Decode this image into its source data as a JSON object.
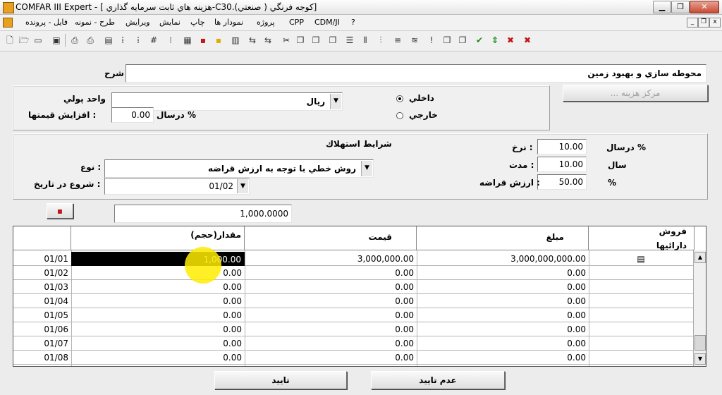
{
  "window": {
    "app_name": "COMFAR III Expert",
    "doc_title": "[ هزينه هاي ثابت سرمايه گذاري-C30.كوجه فرنگي ( صنعتي)]"
  },
  "menu": [
    "فايل - پرونده",
    "طرح - نمونه",
    "ويرايش",
    "نمايش",
    "چاپ",
    "نمودار ها",
    "پروژه",
    "CPP",
    "CDM/JI",
    "?"
  ],
  "form": {
    "description_label": "شرح",
    "description_value": "محوطه سازي و بهبود زمين",
    "currency_label": "واحد پولي",
    "currency_value": "ريال",
    "price_increase_label": ": افزايش قيمتها",
    "price_increase_value": "0.00",
    "percent_per_label": "% درسال",
    "domestic_label": "داخلي",
    "foreign_label": "خارجي",
    "cost_center_button": "... مركز هزينه"
  },
  "depreciation": {
    "title": "شرايط استهلاك",
    "type_label": ": نوع",
    "type_value": "روش خطي با توجه به ارزش قراضه",
    "start_label": ": شروع در تاريخ",
    "start_value": "01/02",
    "rate_label": ": نرخ",
    "rate_value": "10.00",
    "rate_unit": "% درسال",
    "duration_label": ": مدت",
    "duration_value": "10.00",
    "duration_unit": "سال",
    "salvage_label": ": ارزش قراضه",
    "salvage_value": "50.00",
    "salvage_unit": "%"
  },
  "total_value": "1,000.0000",
  "table": {
    "headers": {
      "quantity": "مقدار(حجم)",
      "price": "قيمت",
      "amount": "مبلغ",
      "sale": "فروش",
      "assets": "دارائيها"
    },
    "rows": [
      {
        "period": "01/01",
        "quantity": "1,000.00",
        "price": "3,000,000.00",
        "amount": "3,000,000,000.00"
      },
      {
        "period": "01/02",
        "quantity": "0.00",
        "price": "0.00",
        "amount": "0.00"
      },
      {
        "period": "01/03",
        "quantity": "0.00",
        "price": "0.00",
        "amount": "0.00"
      },
      {
        "period": "01/04",
        "quantity": "0.00",
        "price": "0.00",
        "amount": "0.00"
      },
      {
        "period": "01/05",
        "quantity": "0.00",
        "price": "0.00",
        "amount": "0.00"
      },
      {
        "period": "01/06",
        "quantity": "0.00",
        "price": "0.00",
        "amount": "0.00"
      },
      {
        "period": "01/07",
        "quantity": "0.00",
        "price": "0.00",
        "amount": "0.00"
      },
      {
        "period": "01/08",
        "quantity": "0.00",
        "price": "0.00",
        "amount": "0.00"
      }
    ]
  },
  "buttons": {
    "ok": "تاييد",
    "cancel": "عدم تاييد"
  },
  "icons": {
    "window": [
      "minimize-icon",
      "restore-icon",
      "close-icon"
    ],
    "toolbar": [
      "new-icon",
      "open-icon",
      "folder-icon",
      "save-icon",
      "print-icon",
      "print-preview-icon",
      "table-icon",
      "hash-icon",
      "grid-icon",
      "calculator-icon",
      "chart-icon",
      "cut-icon",
      "copy-icon",
      "paste-icon",
      "check-icon",
      "cross-icon"
    ]
  }
}
